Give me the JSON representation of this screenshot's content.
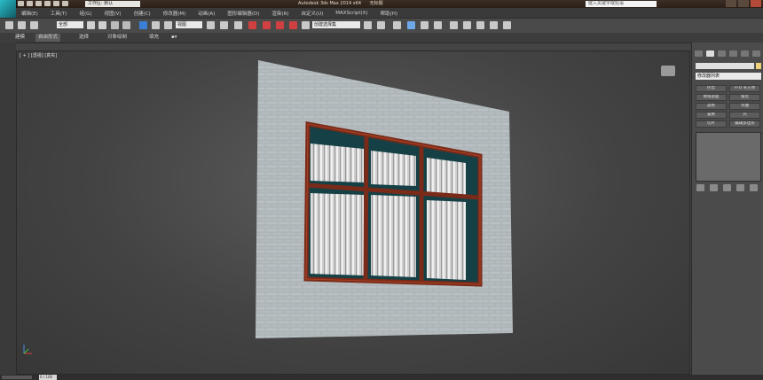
{
  "titlebar": {
    "workspace_value": "工作区: 默认",
    "app_title": "Autodesk 3ds Max  2014 x64",
    "file_name": "无标题",
    "search_placeholder": "键入关键字或短语"
  },
  "menubar": {
    "items": [
      "编辑(E)",
      "工具(T)",
      "组(G)",
      "视图(V)",
      "创建(C)",
      "修改器(M)",
      "动画(A)",
      "图形编辑器(D)",
      "渲染(R)",
      "自定义(U)",
      "MAXScript(X)",
      "帮助(H)"
    ]
  },
  "toolbar": {
    "selection_filter": "全部",
    "coord_system": "视图",
    "named_selection": "创建选择集"
  },
  "ribbon": {
    "tabs": [
      "建模",
      "自由形式",
      "选择",
      "对象绘制",
      "填充"
    ],
    "active_tab": "自由形式"
  },
  "viewport": {
    "label": "[ + ] [透视] [真实]"
  },
  "command_panel": {
    "modifier_list": "修改器列表",
    "modifier_buttons": [
      "挤出",
      "FFD 长方体",
      "倒角剖面",
      "锥化",
      "晶格",
      "弯曲",
      "置换",
      "壳",
      "切片",
      "编辑多边形"
    ]
  },
  "statusbar": {
    "frame_counter": "0 / 100"
  },
  "colors": {
    "wall": "#a9b0b3",
    "frame": "#7a2a18",
    "glass": "#154046",
    "curtain": "#dcdcdc",
    "accent": "#2bbcc6"
  }
}
